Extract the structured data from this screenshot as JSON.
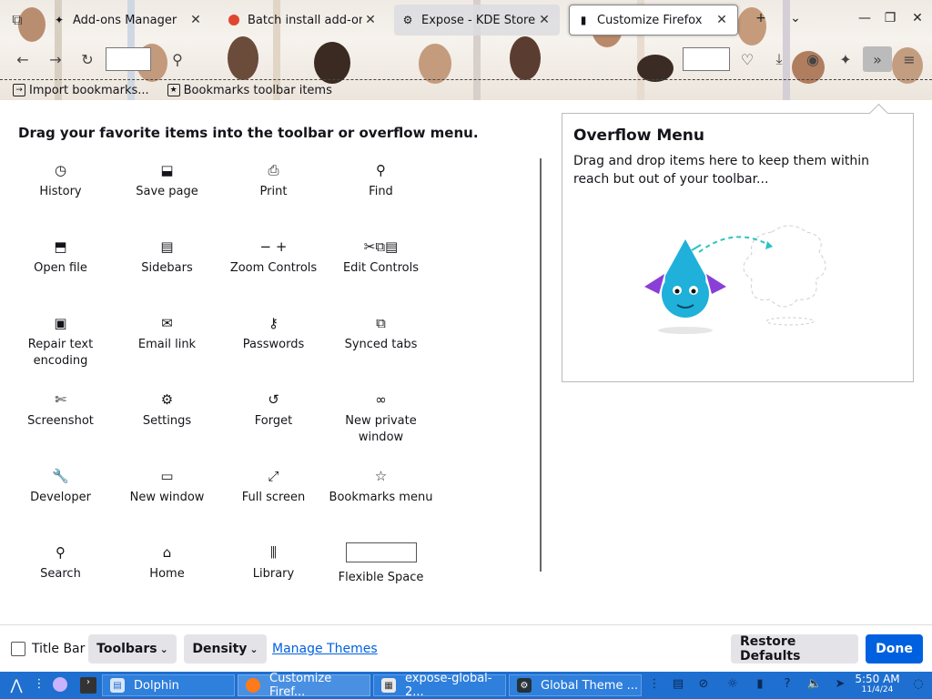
{
  "tabs": [
    {
      "label": "Add-ons Manager",
      "favicon": "puzzle-icon"
    },
    {
      "label": "Batch install add-ons",
      "favicon": "firefox-dot-icon"
    },
    {
      "label": "Expose - KDE Store",
      "favicon": "kde-icon"
    },
    {
      "label": "Customize Firefox",
      "favicon": "paintbrush-icon"
    }
  ],
  "bookmarks": [
    {
      "label": "Import bookmarks...",
      "icon": "import-icon"
    },
    {
      "label": "Bookmarks toolbar items",
      "icon": "star-icon"
    }
  ],
  "palette": {
    "title": "Drag your favorite items into the toolbar or overflow menu.",
    "items": [
      {
        "label": "History",
        "icon": "clock-icon",
        "glyph": "◷"
      },
      {
        "label": "Save page",
        "icon": "save-page-icon",
        "glyph": "⬓"
      },
      {
        "label": "Print",
        "icon": "print-icon",
        "glyph": "⎙"
      },
      {
        "label": "Find",
        "icon": "search-icon",
        "glyph": "⚲"
      },
      {
        "label": "Open file",
        "icon": "open-file-icon",
        "glyph": "⬒"
      },
      {
        "label": "Sidebars",
        "icon": "sidebar-icon",
        "glyph": "▤"
      },
      {
        "label": "Zoom Controls",
        "icon": "zoom-icon",
        "glyph": "− +"
      },
      {
        "label": "Edit Controls",
        "icon": "edit-controls-icon",
        "glyph": "✂⧉▤"
      },
      {
        "label": "Repair text encoding",
        "icon": "encoding-icon",
        "glyph": "▣"
      },
      {
        "label": "Email link",
        "icon": "mail-icon",
        "glyph": "✉"
      },
      {
        "label": "Passwords",
        "icon": "key-icon",
        "glyph": "⚷"
      },
      {
        "label": "Synced tabs",
        "icon": "synced-tabs-icon",
        "glyph": "⧉"
      },
      {
        "label": "Screenshot",
        "icon": "screenshot-icon",
        "glyph": "✄"
      },
      {
        "label": "Settings",
        "icon": "gear-icon",
        "glyph": "⚙"
      },
      {
        "label": "Forget",
        "icon": "forget-icon",
        "glyph": "↺"
      },
      {
        "label": "New private window",
        "icon": "private-mask-icon",
        "glyph": "∞"
      },
      {
        "label": "Developer",
        "icon": "wrench-icon",
        "glyph": "🔧"
      },
      {
        "label": "New window",
        "icon": "window-icon",
        "glyph": "▭"
      },
      {
        "label": "Full screen",
        "icon": "fullscreen-icon",
        "glyph": "⤢"
      },
      {
        "label": "Bookmarks menu",
        "icon": "bookmark-menu-icon",
        "glyph": "☆"
      },
      {
        "label": "Search",
        "icon": "search-icon",
        "glyph": "⚲"
      },
      {
        "label": "Home",
        "icon": "home-icon",
        "glyph": "⌂"
      },
      {
        "label": "Library",
        "icon": "library-icon",
        "glyph": "⫼"
      },
      {
        "label": "Flexible Space",
        "icon": "flexible-space-icon",
        "glyph": ""
      }
    ]
  },
  "overflow": {
    "title": "Overflow Menu",
    "description": "Drag and drop items here to keep them within reach but out of your toolbar..."
  },
  "footer": {
    "title_bar_label": "Title Bar",
    "toolbars_label": "Toolbars",
    "density_label": "Density",
    "manage_themes_label": "Manage Themes",
    "restore_label": "Restore Defaults",
    "done_label": "Done"
  },
  "taskbar": {
    "apps": [
      {
        "label": "Dolphin",
        "icon": "folder-icon"
      },
      {
        "label": "Customize Firef...",
        "icon": "firefox-icon"
      },
      {
        "label": "expose-global-2...",
        "icon": "document-icon"
      },
      {
        "label": "Global Theme ...",
        "icon": "settings-app-icon"
      }
    ],
    "time": "5:50 AM",
    "date": "11/4/24"
  },
  "colors": {
    "accent": "#0061e0",
    "taskbar": "#1e6fcf"
  }
}
